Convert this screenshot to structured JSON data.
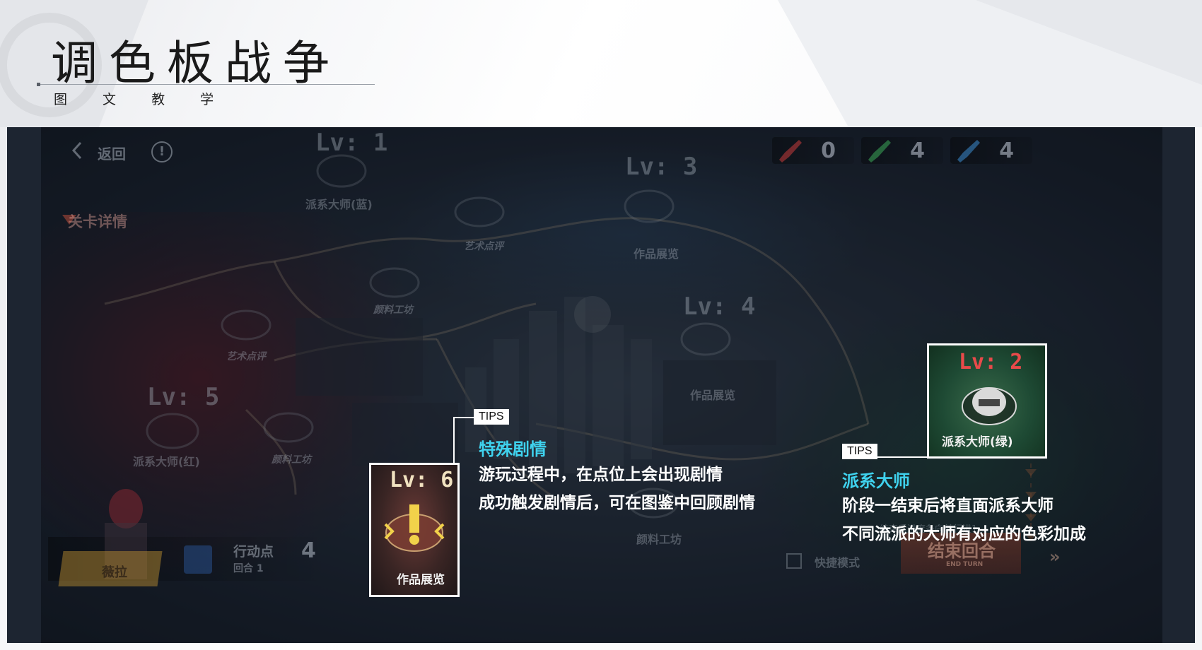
{
  "header": {
    "title": "调色板战争",
    "subtitle": "图 文 教 学"
  },
  "game_ui": {
    "back_label": "返回",
    "info_icon": "!",
    "level_details_label": "关卡详情",
    "resources": [
      {
        "name": "red-paint",
        "value": "0",
        "color": "#c83a3a"
      },
      {
        "name": "green-paint",
        "value": "4",
        "color": "#3fae5a"
      },
      {
        "name": "blue-paint",
        "value": "4",
        "color": "#3a8ed8"
      }
    ],
    "map_levels": [
      "Lv: 1",
      "Lv: 3",
      "Lv: 4",
      "Lv: 5"
    ],
    "map_nodes": [
      "派系大师(蓝)",
      "艺术点评",
      "作品展览",
      "颜料工坊",
      "艺术点评",
      "作品展览",
      "派系大师(红)",
      "颜料工坊",
      "颜料工坊"
    ],
    "progress_hint": "结束后进度条向前行进1",
    "quick_mode_label": "快捷模式",
    "end_turn_label": "结束回合",
    "end_turn_sub": "END TURN",
    "character_name": "薇拉",
    "action_points_label": "行动点",
    "action_points_value": "4",
    "round_label": "回合 1"
  },
  "tips": [
    {
      "tag": "TIPS",
      "title": "特殊剧情",
      "lines": [
        "游玩过程中，在点位上会出现剧情",
        "成功触发剧情后，可在图鉴中回顾剧情"
      ],
      "thumb_level": "Lv: 6",
      "thumb_label": "作品展览"
    },
    {
      "tag": "TIPS",
      "title": "派系大师",
      "lines": [
        "阶段一结束后将直面派系大师",
        "不同流派的大师有对应的色彩加成"
      ],
      "thumb_level": "Lv: 2",
      "thumb_label": "派系大师(绿)"
    }
  ],
  "colors": {
    "tips_title": "#3fd2ee",
    "tips_text": "#ffffff",
    "thumb_lv6": "#f1e2c0",
    "thumb_lv2": "#e84a4a"
  }
}
